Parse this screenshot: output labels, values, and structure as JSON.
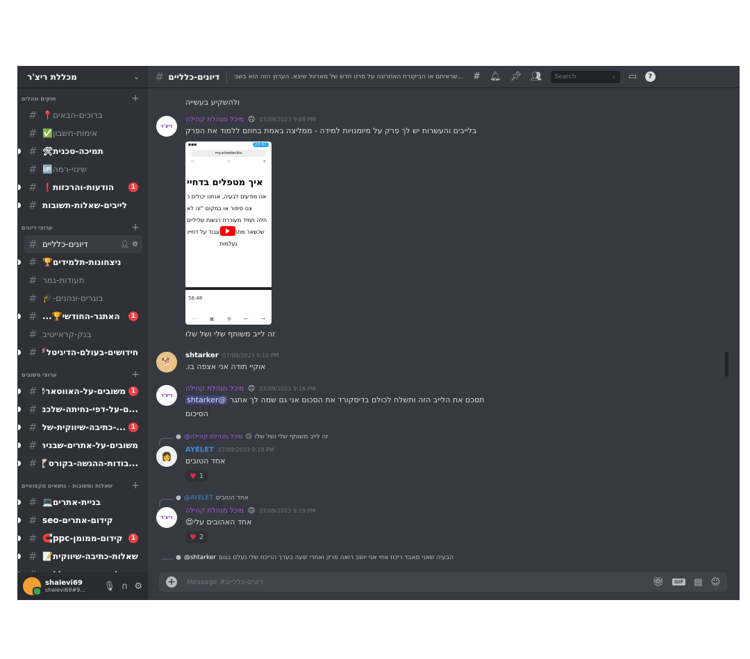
{
  "server": {
    "name": "מכללת ריצ'ר"
  },
  "sidebar": {
    "categories": [
      {
        "name": "חוקים ונהלים",
        "channels": [
          {
            "label": "ברוכים-הבאים📍",
            "unread": false,
            "badge": ""
          },
          {
            "label": "אימות-חשבון✅",
            "unread": false,
            "badge": ""
          },
          {
            "label": "תמיכה-טכנית🛠",
            "unread": true,
            "badge": ""
          },
          {
            "label": "שינוי-רמה🆙",
            "unread": false,
            "badge": ""
          },
          {
            "label": "הודעות-והרכזות❗",
            "unread": true,
            "badge": "1"
          },
          {
            "label": "לייבים-שאלות-תשובות",
            "unread": true,
            "badge": ""
          }
        ]
      },
      {
        "name": "ערוצי דיונים",
        "channels": [
          {
            "label": "דיונים-כלליים",
            "unread": false,
            "badge": "",
            "active": true
          },
          {
            "label": "ניצחונות-תלמידים🏆",
            "unread": true,
            "badge": ""
          },
          {
            "label": "תעודות-גמר",
            "unread": false,
            "badge": ""
          },
          {
            "label": "בוגרים-ונהנים-🎓",
            "unread": false,
            "badge": ""
          },
          {
            "label": "האתגר-החודשי🏆...",
            "unread": true,
            "badge": "1"
          },
          {
            "label": "בנק-קראייטיב",
            "unread": false,
            "badge": ""
          },
          {
            "label": "חידושים-בעולם-הדיגיטל🚀",
            "unread": true,
            "badge": ""
          }
        ]
      },
      {
        "name": "ערוצי משובים",
        "channels": [
          {
            "label": "משובים-על-האווטאר😎",
            "unread": true,
            "badge": "1"
          },
          {
            "label": "...ם-על-דפי-נחיתה-שלכם🛬",
            "unread": true,
            "badge": ""
          },
          {
            "label": "...-כתיבה-שיווקית-שלכם",
            "unread": true,
            "badge": "1"
          },
          {
            "label": "משובים-על-אתרים-שבניתם",
            "unread": true,
            "badge": ""
          },
          {
            "label": "...בודות-ההגשה-בקורס🍸",
            "unread": true,
            "badge": ""
          }
        ]
      },
      {
        "name": "שאלות ותשובות - נושאים מקצועיים",
        "channels": [
          {
            "label": "בניית-אתרים💻",
            "unread": true,
            "badge": ""
          },
          {
            "label": "קידום-אתרים-seo",
            "unread": true,
            "badge": ""
          },
          {
            "label": "קידום-ממומן-ppc🧲",
            "unread": true,
            "badge": "1"
          },
          {
            "label": "שאלות-כתיבה-שיווקית📝",
            "unread": true,
            "badge": ""
          },
          {
            "label": "שאלות-ותשובות-כלליות",
            "unread": true,
            "badge": ""
          }
        ]
      }
    ]
  },
  "user": {
    "name": "shalevi69",
    "tag": "shalevi69#9..."
  },
  "topbar": {
    "channel": "דיונים-כלליים",
    "topic": "...שראיתם או הביקורת האחרונה על סרט חדש של מארוול שיצא. הערוץ הזה הוא בשבילכם! תתפרעו",
    "search_placeholder": "Search"
  },
  "messages": {
    "top_text": "ולהשקיע בעשייה",
    "m1": {
      "author": "מיכל מנהלת קהילה",
      "time": "07/09/2023 9:08 PM",
      "avatar": "ריצ'ר",
      "text": "בלייבים והעשרות יש לך פרק על מיומנויות למידה - ממליצה באמת בחוזם ללמוד את הפרק",
      "caption": "זה לייב משותף שלי ושל שלו"
    },
    "phone": {
      "clock": "23:07",
      "url": "my.schooler.biz",
      "heading": "איך מטפלים בדחיי",
      "line1": "אנו מודעים לבעיה, אנחנו יכולים כ",
      "line2": "צנו סיפור או במקום \"זה לא",
      "line3": "חלה תמיד מעוררת רגשות שליליים",
      "line4": "שכשאר מתחילים לעבוד על דחיינ",
      "line5": "נעלמות",
      "duration": "58:48"
    },
    "m2": {
      "author": "shtarker",
      "time": "07/09/2023 9:10 PM",
      "text": "אוקיי תודה אני אצפה בו."
    },
    "m3": {
      "author": "מיכל מנהלת קהילה",
      "time": "07/09/2023 9:16 PM",
      "mention": "@shtarker",
      "text": "תסכם את הלייב הזה ותשלח לכולם בדיסקורד את הסכום אני גם שמה לך אתגר",
      "text2": "הסיכום"
    },
    "m4": {
      "reply_text": "זה לייב משותף שלי ושל שלו",
      "reply_author": "@מיכל מנהלת קהילה",
      "author": "AYELET",
      "time": "07/09/2023 9:18 PM",
      "text": "אחד הטובים",
      "reaction_count": "1"
    },
    "m5": {
      "reply_text": "אחד הטובים",
      "reply_author": "@AYELET",
      "author": "מיכל מנהלת קהילה",
      "time": "07/09/2023 9:19 PM",
      "text": "אחד האהובים עלי😍",
      "reaction_count": "2"
    },
    "m6": {
      "reply_author": "@shtarker",
      "reply_text": "הבעיה שאני מאבד ריכוז אחי אני יושב רואה פרק ואחרי שעה בערך הריכוז שלי נעלם בגום"
    }
  },
  "composer": {
    "placeholder": "Message #דיונים-כלליים"
  },
  "colors": {
    "background": "#36393f",
    "sidebar": "#2f3136",
    "accent": "#5865f2",
    "mod_role": "#a45ed6",
    "badge": "#ed4245"
  }
}
